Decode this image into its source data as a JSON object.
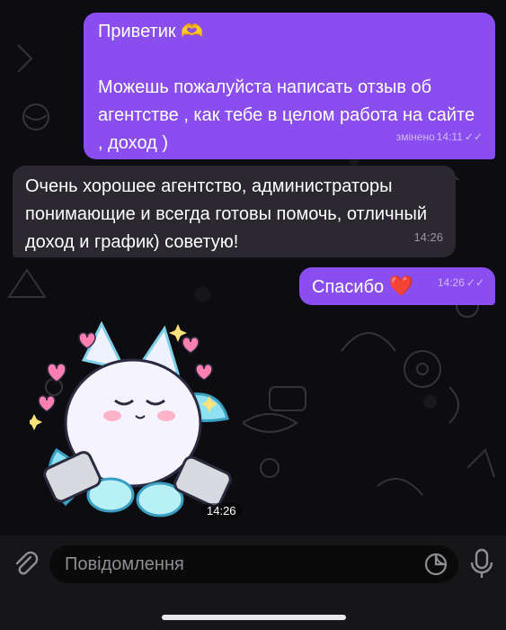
{
  "messages": [
    {
      "line1": "Приветик 🫶",
      "text": "Можешь пожалуйста  написать отзыв об агентстве , как тебе в целом работа на сайте , доход )",
      "edited": "змінено",
      "time": "14:11",
      "status": "✓✓"
    },
    {
      "text": "Очень хорошее агентство, администраторы понимающие и всегда готовы помочь, отличный доход и график) советую!",
      "time": "14:26"
    },
    {
      "text": "Спасибо",
      "emoji": "❤️",
      "time": "14:26",
      "status": "✓✓"
    }
  ],
  "sticker": {
    "time": "14:26",
    "icon": "fluffy-creature-sticker"
  },
  "composer": {
    "placeholder": "Повідомлення",
    "attach_icon": "paperclip-icon",
    "sticker_icon": "sticker-icon",
    "mic_icon": "microphone-icon"
  },
  "colors": {
    "outgoing": "#8a4ef0",
    "incoming": "#2b2830",
    "background": "#0d0c10",
    "heart": "#e0203a"
  }
}
